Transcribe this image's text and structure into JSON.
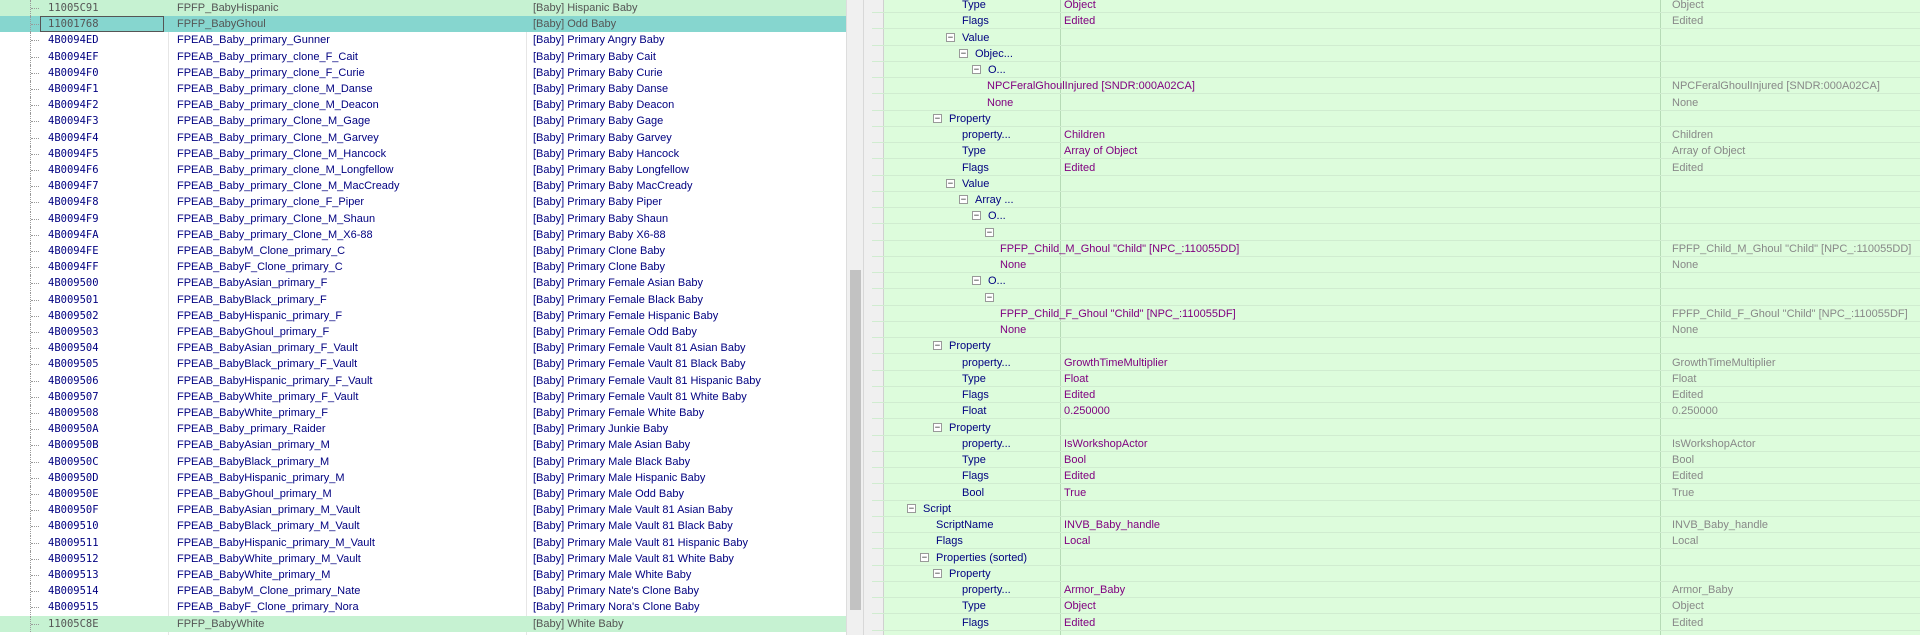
{
  "left_list": {
    "rows": [
      {
        "formid": "11005C91",
        "editorid": "FPFP_BabyHispanic",
        "name": "[Baby] Hispanic Baby",
        "state": "hl"
      },
      {
        "formid": "11001768",
        "editorid": "FPFP_BabyGhoul",
        "name": "[Baby] Odd Baby",
        "state": "sel"
      },
      {
        "formid": "4B0094ED",
        "editorid": "FPEAB_Baby_primary_Gunner",
        "name": "[Baby] Primary Angry Baby",
        "state": ""
      },
      {
        "formid": "4B0094EF",
        "editorid": "FPEAB_Baby_primary_clone_F_Cait",
        "name": "[Baby] Primary Baby Cait",
        "state": ""
      },
      {
        "formid": "4B0094F0",
        "editorid": "FPEAB_Baby_primary_clone_F_Curie",
        "name": "[Baby] Primary Baby Curie",
        "state": ""
      },
      {
        "formid": "4B0094F1",
        "editorid": "FPEAB_Baby_primary_clone_M_Danse",
        "name": "[Baby] Primary Baby Danse",
        "state": ""
      },
      {
        "formid": "4B0094F2",
        "editorid": "FPEAB_Baby_primary_clone_M_Deacon",
        "name": "[Baby] Primary Baby Deacon",
        "state": ""
      },
      {
        "formid": "4B0094F3",
        "editorid": "FPEAB_Baby_primary_Clone_M_Gage",
        "name": "[Baby] Primary Baby Gage",
        "state": ""
      },
      {
        "formid": "4B0094F4",
        "editorid": "FPEAB_Baby_primary_Clone_M_Garvey",
        "name": "[Baby] Primary Baby Garvey",
        "state": ""
      },
      {
        "formid": "4B0094F5",
        "editorid": "FPEAB_Baby_primary_Clone_M_Hancock",
        "name": "[Baby] Primary Baby Hancock",
        "state": ""
      },
      {
        "formid": "4B0094F6",
        "editorid": "FPEAB_Baby_primary_clone_M_Longfellow",
        "name": "[Baby] Primary Baby Longfellow",
        "state": ""
      },
      {
        "formid": "4B0094F7",
        "editorid": "FPEAB_Baby_primary_Clone_M_MacCready",
        "name": "[Baby] Primary Baby MacCready",
        "state": ""
      },
      {
        "formid": "4B0094F8",
        "editorid": "FPEAB_Baby_primary_clone_F_Piper",
        "name": "[Baby] Primary Baby Piper",
        "state": ""
      },
      {
        "formid": "4B0094F9",
        "editorid": "FPEAB_Baby_primary_Clone_M_Shaun",
        "name": "[Baby] Primary Baby Shaun",
        "state": ""
      },
      {
        "formid": "4B0094FA",
        "editorid": "FPEAB_Baby_primary_Clone_M_X6-88",
        "name": "[Baby] Primary Baby X6-88",
        "state": ""
      },
      {
        "formid": "4B0094FE",
        "editorid": "FPEAB_BabyM_Clone_primary_C",
        "name": "[Baby] Primary Clone Baby",
        "state": ""
      },
      {
        "formid": "4B0094FF",
        "editorid": "FPEAB_BabyF_Clone_primary_C",
        "name": "[Baby] Primary Clone Baby",
        "state": ""
      },
      {
        "formid": "4B009500",
        "editorid": "FPEAB_BabyAsian_primary_F",
        "name": "[Baby] Primary Female Asian Baby",
        "state": ""
      },
      {
        "formid": "4B009501",
        "editorid": "FPEAB_BabyBlack_primary_F",
        "name": "[Baby] Primary Female Black Baby",
        "state": ""
      },
      {
        "formid": "4B009502",
        "editorid": "FPEAB_BabyHispanic_primary_F",
        "name": "[Baby] Primary Female Hispanic Baby",
        "state": ""
      },
      {
        "formid": "4B009503",
        "editorid": "FPEAB_BabyGhoul_primary_F",
        "name": "[Baby] Primary Female Odd Baby",
        "state": ""
      },
      {
        "formid": "4B009504",
        "editorid": "FPEAB_BabyAsian_primary_F_Vault",
        "name": "[Baby] Primary Female Vault 81 Asian Baby",
        "state": ""
      },
      {
        "formid": "4B009505",
        "editorid": "FPEAB_BabyBlack_primary_F_Vault",
        "name": "[Baby] Primary Female Vault 81 Black Baby",
        "state": ""
      },
      {
        "formid": "4B009506",
        "editorid": "FPEAB_BabyHispanic_primary_F_Vault",
        "name": "[Baby] Primary Female Vault 81 Hispanic Baby",
        "state": ""
      },
      {
        "formid": "4B009507",
        "editorid": "FPEAB_BabyWhite_primary_F_Vault",
        "name": "[Baby] Primary Female Vault 81 White Baby",
        "state": ""
      },
      {
        "formid": "4B009508",
        "editorid": "FPEAB_BabyWhite_primary_F",
        "name": "[Baby] Primary Female White Baby",
        "state": ""
      },
      {
        "formid": "4B00950A",
        "editorid": "FPEAB_Baby_primary_Raider",
        "name": "[Baby] Primary Junkie Baby",
        "state": ""
      },
      {
        "formid": "4B00950B",
        "editorid": "FPEAB_BabyAsian_primary_M",
        "name": "[Baby] Primary Male Asian Baby",
        "state": ""
      },
      {
        "formid": "4B00950C",
        "editorid": "FPEAB_BabyBlack_primary_M",
        "name": "[Baby] Primary Male Black Baby",
        "state": ""
      },
      {
        "formid": "4B00950D",
        "editorid": "FPEAB_BabyHispanic_primary_M",
        "name": "[Baby] Primary Male Hispanic Baby",
        "state": ""
      },
      {
        "formid": "4B00950E",
        "editorid": "FPEAB_BabyGhoul_primary_M",
        "name": "[Baby] Primary Male Odd Baby",
        "state": ""
      },
      {
        "formid": "4B00950F",
        "editorid": "FPEAB_BabyAsian_primary_M_Vault",
        "name": "[Baby] Primary Male Vault 81 Asian Baby",
        "state": ""
      },
      {
        "formid": "4B009510",
        "editorid": "FPEAB_BabyBlack_primary_M_Vault",
        "name": "[Baby] Primary Male Vault 81 Black Baby",
        "state": ""
      },
      {
        "formid": "4B009511",
        "editorid": "FPEAB_BabyHispanic_primary_M_Vault",
        "name": "[Baby] Primary Male Vault 81 Hispanic Baby",
        "state": ""
      },
      {
        "formid": "4B009512",
        "editorid": "FPEAB_BabyWhite_primary_M_Vault",
        "name": "[Baby] Primary Male Vault 81 White Baby",
        "state": ""
      },
      {
        "formid": "4B009513",
        "editorid": "FPEAB_BabyWhite_primary_M",
        "name": "[Baby] Primary Male White Baby",
        "state": ""
      },
      {
        "formid": "4B009514",
        "editorid": "FPEAB_BabyM_Clone_primary_Nate",
        "name": "[Baby] Primary Nate's Clone Baby",
        "state": ""
      },
      {
        "formid": "4B009515",
        "editorid": "FPEAB_BabyF_Clone_primary_Nora",
        "name": "[Baby] Primary Nora's Clone Baby",
        "state": ""
      },
      {
        "formid": "11005C8E",
        "editorid": "FPFP_BabyWhite",
        "name": "[Baby] White Baby",
        "state": "hl"
      }
    ]
  },
  "right_tree": {
    "rows": [
      {
        "level": 4,
        "exp": "",
        "label": "Type",
        "v1": "Object",
        "v2": "Object"
      },
      {
        "level": 4,
        "exp": "",
        "label": "Flags",
        "v1": "Edited",
        "v2": "Edited"
      },
      {
        "level": 4,
        "exp": "−",
        "label": "Value",
        "v1": "",
        "v2": ""
      },
      {
        "level": 5,
        "exp": "−",
        "label": "Objec...",
        "v1": "",
        "v2": ""
      },
      {
        "level": 6,
        "exp": "−",
        "label": "O...",
        "v1": "",
        "v2": ""
      },
      {
        "level": 7,
        "exp": "",
        "label": "",
        "v1": "NPCFeralGhoulInjured [SNDR:000A02CA]",
        "v2": "NPCFeralGhoulInjured [SNDR:000A02CA]"
      },
      {
        "level": 7,
        "exp": "",
        "label": "",
        "v1": "None",
        "v2": "None"
      },
      {
        "level": 3,
        "exp": "−",
        "label": "Property",
        "v1": "",
        "v2": ""
      },
      {
        "level": 4,
        "exp": "",
        "label": "property...",
        "v1": "Children",
        "v2": "Children"
      },
      {
        "level": 4,
        "exp": "",
        "label": "Type",
        "v1": "Array of Object",
        "v2": "Array of Object"
      },
      {
        "level": 4,
        "exp": "",
        "label": "Flags",
        "v1": "Edited",
        "v2": "Edited"
      },
      {
        "level": 4,
        "exp": "−",
        "label": "Value",
        "v1": "",
        "v2": ""
      },
      {
        "level": 5,
        "exp": "−",
        "label": "Array ...",
        "v1": "",
        "v2": ""
      },
      {
        "level": 6,
        "exp": "−",
        "label": "O...",
        "v1": "",
        "v2": ""
      },
      {
        "level": 7,
        "exp": "−",
        "label": "",
        "v1": "",
        "v2": ""
      },
      {
        "level": 8,
        "exp": "",
        "label": "",
        "v1": "FPFP_Child_M_Ghoul \"Child\" [NPC_:110055DD]",
        "v2": "FPFP_Child_M_Ghoul \"Child\" [NPC_:110055DD]"
      },
      {
        "level": 8,
        "exp": "",
        "label": "",
        "v1": "None",
        "v2": "None"
      },
      {
        "level": 6,
        "exp": "−",
        "label": "O...",
        "v1": "",
        "v2": ""
      },
      {
        "level": 7,
        "exp": "−",
        "label": "",
        "v1": "",
        "v2": ""
      },
      {
        "level": 8,
        "exp": "",
        "label": "",
        "v1": "FPFP_Child_F_Ghoul \"Child\" [NPC_:110055DF]",
        "v2": "FPFP_Child_F_Ghoul \"Child\" [NPC_:110055DF]"
      },
      {
        "level": 8,
        "exp": "",
        "label": "",
        "v1": "None",
        "v2": "None"
      },
      {
        "level": 3,
        "exp": "−",
        "label": "Property",
        "v1": "",
        "v2": ""
      },
      {
        "level": 4,
        "exp": "",
        "label": "property...",
        "v1": "GrowthTimeMultiplier",
        "v2": "GrowthTimeMultiplier"
      },
      {
        "level": 4,
        "exp": "",
        "label": "Type",
        "v1": "Float",
        "v2": "Float"
      },
      {
        "level": 4,
        "exp": "",
        "label": "Flags",
        "v1": "Edited",
        "v2": "Edited"
      },
      {
        "level": 4,
        "exp": "",
        "label": "Float",
        "v1": "0.250000",
        "v2": "0.250000"
      },
      {
        "level": 3,
        "exp": "−",
        "label": "Property",
        "v1": "",
        "v2": ""
      },
      {
        "level": 4,
        "exp": "",
        "label": "property...",
        "v1": "IsWorkshopActor",
        "v2": "IsWorkshopActor"
      },
      {
        "level": 4,
        "exp": "",
        "label": "Type",
        "v1": "Bool",
        "v2": "Bool"
      },
      {
        "level": 4,
        "exp": "",
        "label": "Flags",
        "v1": "Edited",
        "v2": "Edited"
      },
      {
        "level": 4,
        "exp": "",
        "label": "Bool",
        "v1": "True",
        "v2": "True"
      },
      {
        "level": 1,
        "exp": "−",
        "label": "Script",
        "v1": "",
        "v2": ""
      },
      {
        "level": 2,
        "exp": "",
        "label": "ScriptName",
        "v1": "INVB_Baby_handle",
        "v2": "INVB_Baby_handle"
      },
      {
        "level": 2,
        "exp": "",
        "label": "Flags",
        "v1": "Local",
        "v2": "Local"
      },
      {
        "level": 2,
        "exp": "−",
        "label": "Properties (sorted)",
        "v1": "",
        "v2": ""
      },
      {
        "level": 3,
        "exp": "−",
        "label": "Property",
        "v1": "",
        "v2": ""
      },
      {
        "level": 4,
        "exp": "",
        "label": "property...",
        "v1": "Armor_Baby",
        "v2": "Armor_Baby"
      },
      {
        "level": 4,
        "exp": "",
        "label": "Type",
        "v1": "Object",
        "v2": "Object"
      },
      {
        "level": 4,
        "exp": "",
        "label": "Flags",
        "v1": "Edited",
        "v2": "Edited"
      }
    ]
  }
}
